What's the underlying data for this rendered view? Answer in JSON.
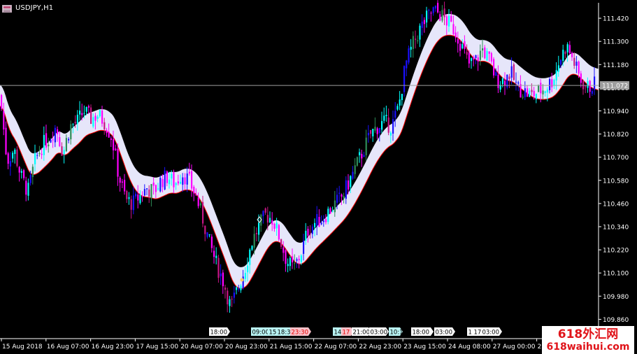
{
  "window": {
    "title": "USDJPY,H1"
  },
  "watermark": {
    "line1": "618外汇网",
    "line2": "618waihui.com"
  },
  "colors": {
    "background": "#000000",
    "axis": "#ffffff",
    "text": "#ffffff",
    "candle_up_strong": "#1a10ff",
    "candle_up": "#00ffff",
    "candle_up_weak": "#2e8b57",
    "candle_down": "#ff00ff",
    "candle_down_weak": "#c71585",
    "band_fill": "#e6e6fa",
    "band_lower_edge": "#ff0000",
    "price_line": "#9e9e9e",
    "price_box": "#9e9e9e",
    "session_tag_bg": "#ffffff",
    "session_tag_cyan": "#b9f3f3",
    "session_tag_pink": "#f8c0c8",
    "session_tag_red": "#e80000"
  },
  "chart_data": {
    "type": "candlestick",
    "symbol": "USDJPY",
    "timeframe": "H1",
    "ylim": [
      109.76,
      111.5
    ],
    "current_price": "111.072",
    "current_price_value": 111.072,
    "y_ticks": [
      "111.420",
      "111.300",
      "111.180",
      "111.060",
      "110.940",
      "110.820",
      "110.700",
      "110.580",
      "110.460",
      "110.340",
      "110.220",
      "110.100",
      "109.980",
      "109.860"
    ],
    "y_tick_values": [
      111.42,
      111.3,
      111.18,
      111.06,
      110.94,
      110.82,
      110.7,
      110.58,
      110.46,
      110.34,
      110.22,
      110.1,
      109.98,
      109.86
    ],
    "x_ticks": [
      "15 Aug 2018",
      "16 Aug 07:00",
      "16 Aug 23:00",
      "17 Aug 15:00",
      "20 Aug 07:00",
      "20 Aug 23:00",
      "21 Aug 15:00",
      "22 Aug 07:00",
      "22 Aug 23:00",
      "23 Aug 15:00",
      "24 Aug 08:00",
      "27 Aug 00:00",
      "27 Aug 16:00"
    ],
    "session_tags": [
      {
        "text": "18:00",
        "style": "white"
      },
      {
        "text": "09:00",
        "style": "cyan"
      },
      {
        "text": "15",
        "style": "cyan"
      },
      {
        "text": "18:3",
        "style": "cyan"
      },
      {
        "text": "23:30",
        "style": "red"
      },
      {
        "text": "14",
        "style": "cyan"
      },
      {
        "text": "17",
        "style": "red"
      },
      {
        "text": "21:00",
        "style": "white"
      },
      {
        "text": "03:00",
        "style": "white"
      },
      {
        "text": "10:1",
        "style": "cyan"
      },
      {
        "text": "18:00",
        "style": "white"
      },
      {
        "text": "03:00",
        "style": "white"
      },
      {
        "text": "1",
        "style": "white"
      },
      {
        "text": "17",
        "style": "white"
      },
      {
        "text": "03:00",
        "style": "white"
      }
    ],
    "close_path": [
      [
        0,
        111.02
      ],
      [
        10,
        110.68
      ],
      [
        20,
        110.74
      ],
      [
        30,
        110.6
      ],
      [
        40,
        110.52
      ],
      [
        50,
        110.68
      ],
      [
        60,
        110.76
      ],
      [
        70,
        110.8
      ],
      [
        80,
        110.86
      ],
      [
        90,
        110.72
      ],
      [
        100,
        110.86
      ],
      [
        110,
        110.88
      ],
      [
        120,
        110.94
      ],
      [
        130,
        110.9
      ],
      [
        140,
        110.92
      ],
      [
        150,
        110.88
      ],
      [
        160,
        110.8
      ],
      [
        170,
        110.6
      ],
      [
        180,
        110.48
      ],
      [
        190,
        110.46
      ],
      [
        200,
        110.5
      ],
      [
        210,
        110.54
      ],
      [
        220,
        110.52
      ],
      [
        230,
        110.58
      ],
      [
        240,
        110.6
      ],
      [
        250,
        110.56
      ],
      [
        260,
        110.62
      ],
      [
        270,
        110.58
      ],
      [
        280,
        110.5
      ],
      [
        290,
        110.38
      ],
      [
        300,
        110.25
      ],
      [
        310,
        110.14
      ],
      [
        320,
        110.05
      ],
      [
        330,
        109.92
      ],
      [
        340,
        110.02
      ],
      [
        350,
        110.12
      ],
      [
        360,
        110.26
      ],
      [
        370,
        110.34
      ],
      [
        380,
        110.4
      ],
      [
        390,
        110.38
      ],
      [
        400,
        110.28
      ],
      [
        410,
        110.16
      ],
      [
        420,
        110.12
      ],
      [
        430,
        110.2
      ],
      [
        440,
        110.32
      ],
      [
        450,
        110.36
      ],
      [
        460,
        110.38
      ],
      [
        470,
        110.42
      ],
      [
        480,
        110.46
      ],
      [
        490,
        110.5
      ],
      [
        500,
        110.58
      ],
      [
        510,
        110.66
      ],
      [
        520,
        110.74
      ],
      [
        530,
        110.82
      ],
      [
        540,
        110.86
      ],
      [
        550,
        110.88
      ],
      [
        560,
        110.86
      ],
      [
        570,
        110.96
      ],
      [
        580,
        111.18
      ],
      [
        590,
        111.28
      ],
      [
        600,
        111.36
      ],
      [
        610,
        111.42
      ],
      [
        620,
        111.46
      ],
      [
        630,
        111.44
      ],
      [
        640,
        111.4
      ],
      [
        650,
        111.36
      ],
      [
        660,
        111.28
      ],
      [
        670,
        111.18
      ],
      [
        680,
        111.2
      ],
      [
        690,
        111.26
      ],
      [
        700,
        111.2
      ],
      [
        710,
        111.1
      ],
      [
        720,
        111.1
      ],
      [
        730,
        111.14
      ],
      [
        740,
        111.06
      ],
      [
        750,
        111.04
      ],
      [
        760,
        111.02
      ],
      [
        770,
        111.04
      ],
      [
        780,
        111.06
      ],
      [
        790,
        111.1
      ],
      [
        800,
        111.2
      ],
      [
        810,
        111.28
      ],
      [
        820,
        111.2
      ],
      [
        830,
        111.1
      ],
      [
        840,
        111.06
      ],
      [
        850,
        111.08
      ]
    ]
  }
}
